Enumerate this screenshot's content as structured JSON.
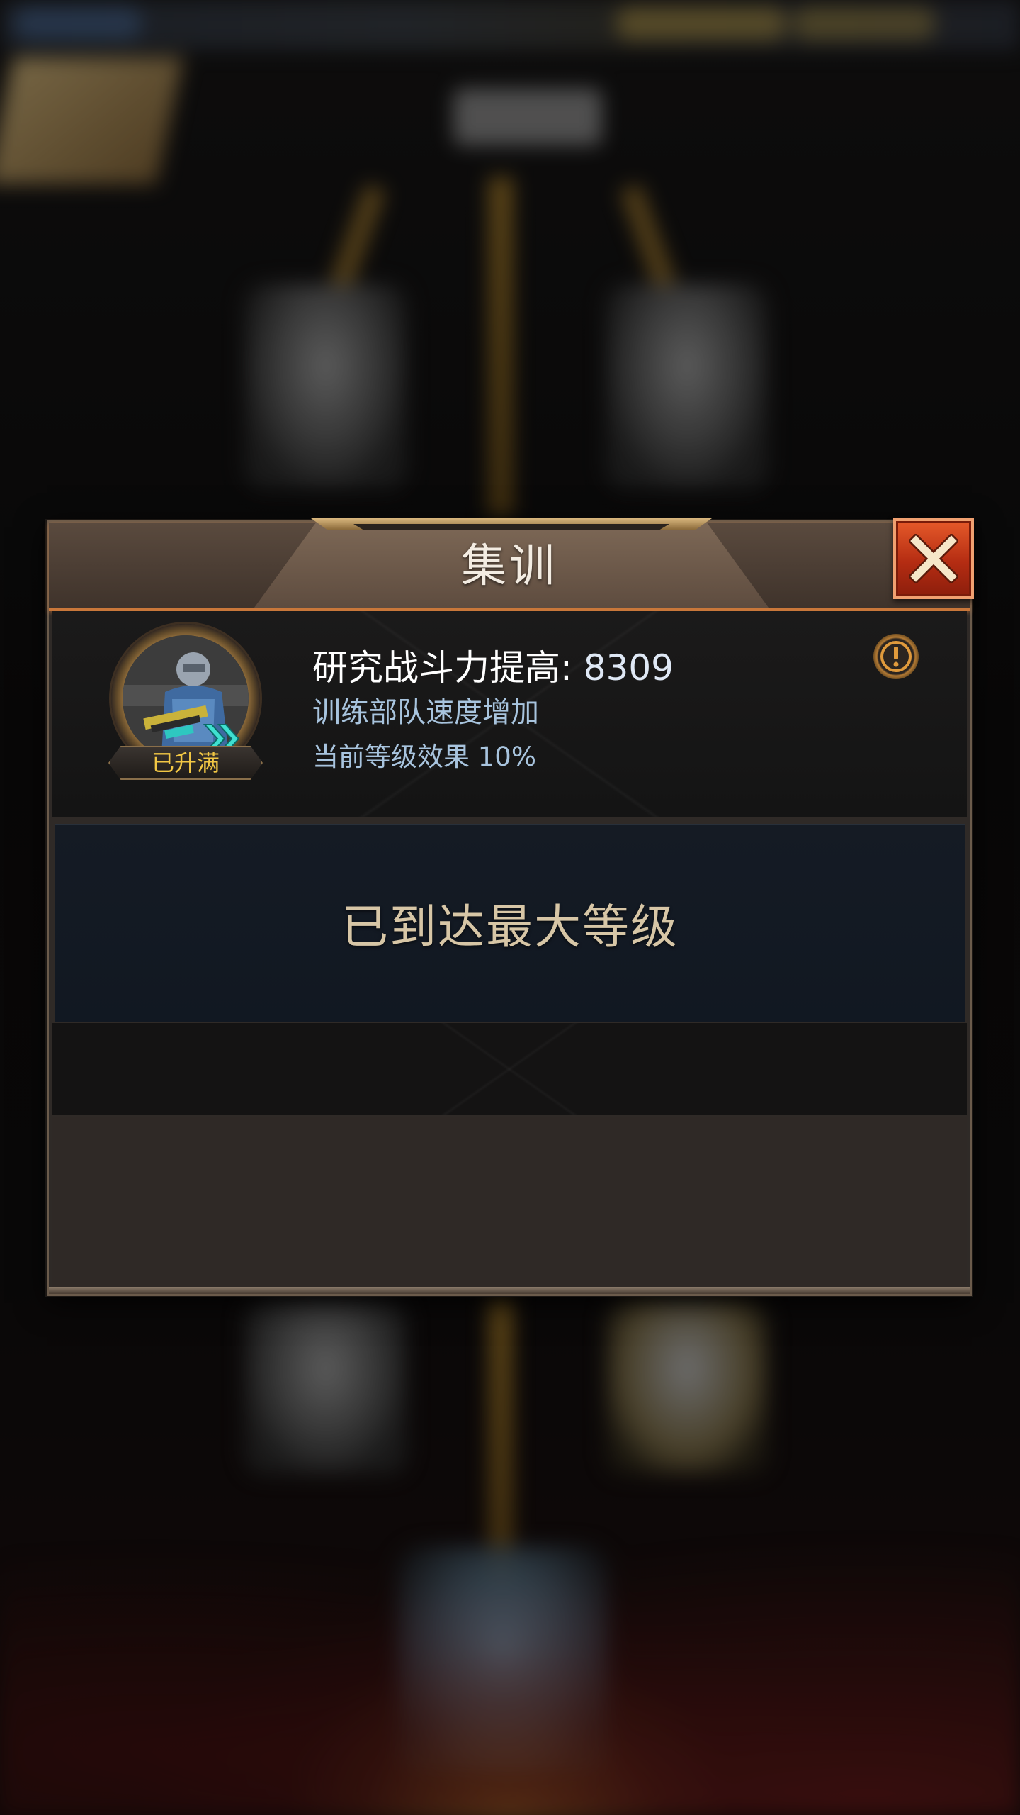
{
  "dialog": {
    "title": "集训",
    "close_icon": "close-x-icon"
  },
  "research": {
    "power_label": "研究战斗力提高: ",
    "power_value": "8309",
    "effect_name": "训练部队速度增加",
    "current_effect": "当前等级效果 10%",
    "level_badge": "已升满",
    "info_icon": "exclamation-circle-icon"
  },
  "status": {
    "max_level_text": "已到达最大等级"
  },
  "colors": {
    "accent_orange": "#c9773a",
    "close_red": "#b42c12",
    "badge_gold": "#f2c744",
    "info_blue": "#a8c4de",
    "max_text": "#d7c6a6"
  }
}
